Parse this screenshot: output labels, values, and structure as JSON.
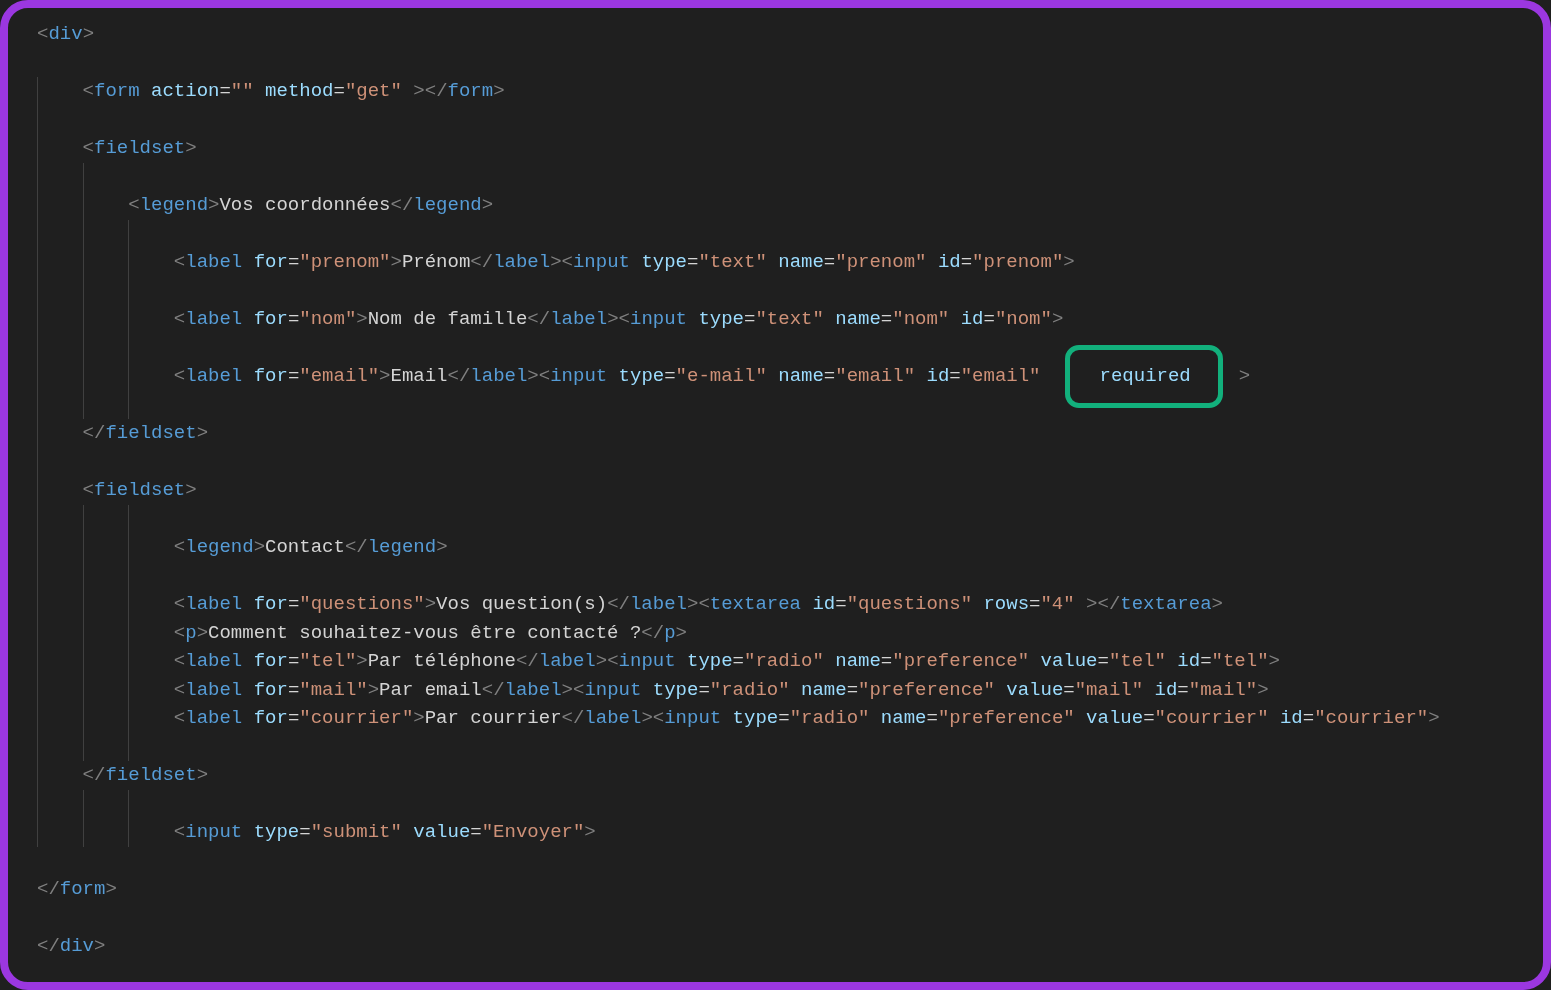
{
  "editor": {
    "lines": [
      {
        "kind": "code",
        "text": "<div>"
      },
      {
        "kind": "blank"
      },
      {
        "kind": "code",
        "text": "    <form action=\"\" method=\"get\" ></form>"
      },
      {
        "kind": "blank"
      },
      {
        "kind": "code",
        "text": "    <fieldset>"
      },
      {
        "kind": "blank"
      },
      {
        "kind": "code",
        "text": "        <legend>Vos coordonnées</legend>"
      },
      {
        "kind": "blank"
      },
      {
        "kind": "code",
        "text": "            <label for=\"prenom\">Prénom</label><input type=\"text\" name=\"prenom\" id=\"prenom\">"
      },
      {
        "kind": "blank"
      },
      {
        "kind": "code",
        "text": "            <label for=\"nom\">Nom de famille</label><input type=\"text\" name=\"nom\" id=\"nom\">"
      },
      {
        "kind": "blank"
      },
      {
        "kind": "code",
        "text": "            <label for=\"email\">Email</label><input type=\"e-mail\" name=\"email\" id=\"email\"",
        "annotation": "required",
        "after": ">"
      },
      {
        "kind": "blank"
      },
      {
        "kind": "code",
        "text": "    </fieldset>"
      },
      {
        "kind": "blank"
      },
      {
        "kind": "code",
        "text": "    <fieldset>"
      },
      {
        "kind": "blank"
      },
      {
        "kind": "code",
        "text": "            <legend>Contact</legend>"
      },
      {
        "kind": "blank"
      },
      {
        "kind": "code",
        "text": "            <label for=\"questions\">Vos question(s)</label><textarea id=\"questions\" rows=\"4\" ></textarea>"
      },
      {
        "kind": "code",
        "text": "            <p>Comment souhaitez-vous être contacté ?</p>"
      },
      {
        "kind": "code",
        "text": "            <label for=\"tel\">Par téléphone</label><input type=\"radio\" name=\"preference\" value=\"tel\" id=\"tel\">"
      },
      {
        "kind": "code",
        "text": "            <label for=\"mail\">Par email</label><input type=\"radio\" name=\"preference\" value=\"mail\" id=\"mail\">"
      },
      {
        "kind": "code",
        "text": "            <label for=\"courrier\">Par courrier</label><input type=\"radio\" name=\"preference\" value=\"courrier\" id=\"courrier\">"
      },
      {
        "kind": "blank"
      },
      {
        "kind": "code",
        "text": "    </fieldset>"
      },
      {
        "kind": "blank"
      },
      {
        "kind": "code",
        "text": "            <input type=\"submit\" value=\"Envoyer\">"
      },
      {
        "kind": "blank"
      },
      {
        "kind": "code",
        "text": "</form>"
      },
      {
        "kind": "blank"
      },
      {
        "kind": "code",
        "text": "</div>"
      }
    ]
  }
}
